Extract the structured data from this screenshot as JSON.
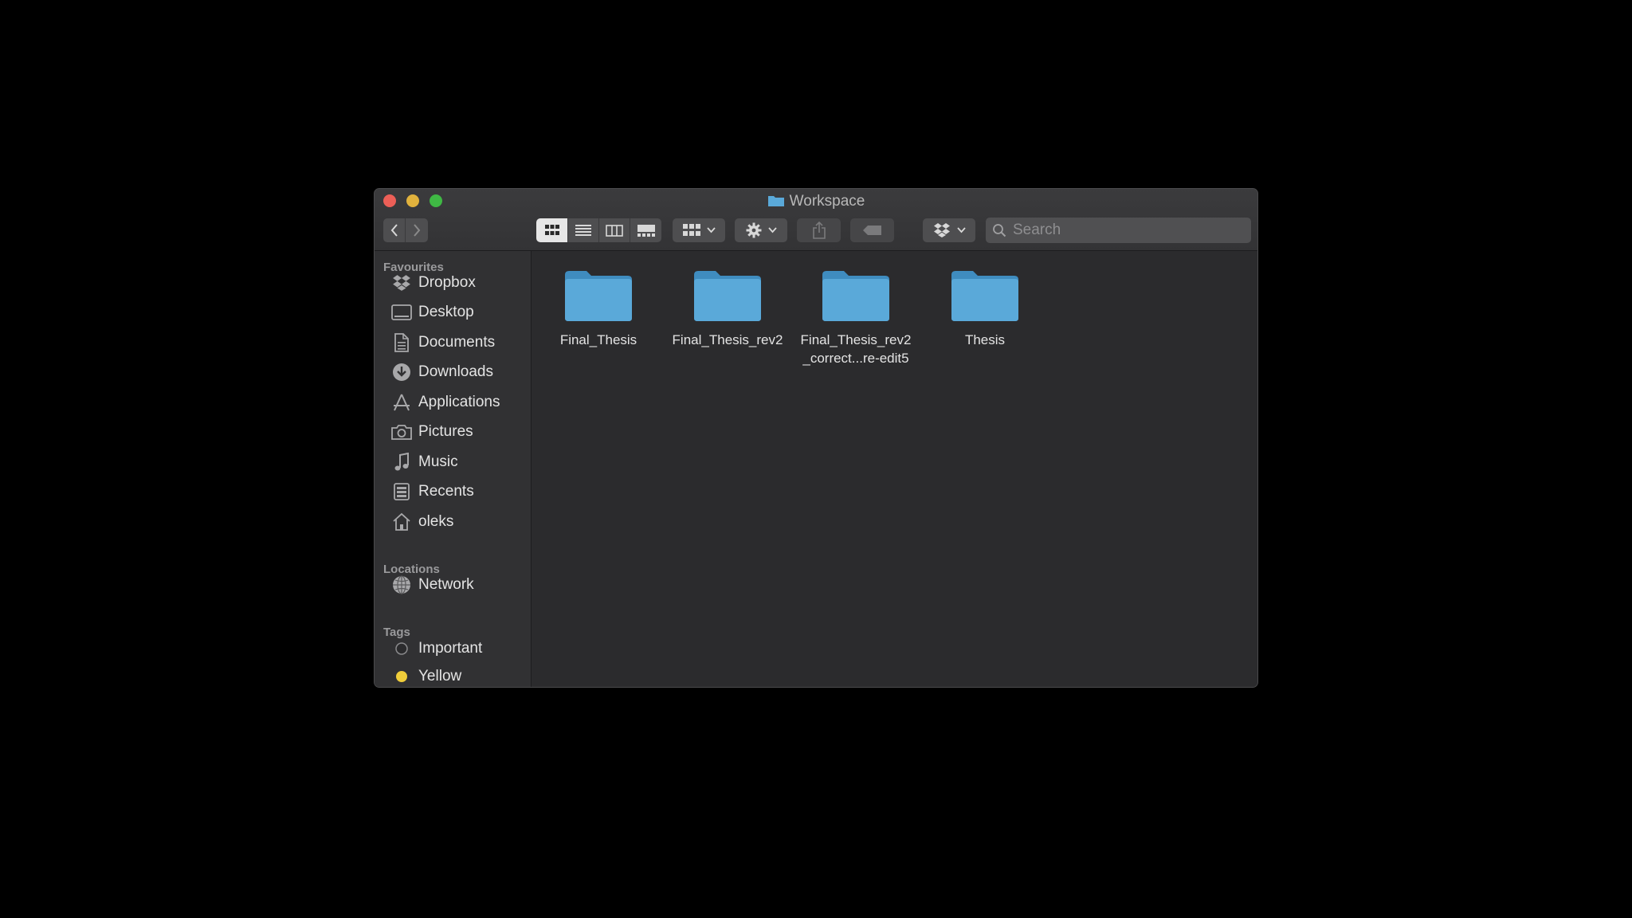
{
  "window": {
    "title": "Workspace"
  },
  "toolbar": {
    "back_icon": "chevron-left-icon",
    "forward_icon": "chevron-right-icon",
    "view_modes": [
      "icon-view",
      "list-view",
      "column-view",
      "gallery-view"
    ],
    "active_view": "icon-view",
    "group_icon": "grid-group-icon",
    "action_icon": "gear-icon",
    "share_icon": "share-icon",
    "tag_icon": "tag-icon",
    "dropbox_icon": "dropbox-icon"
  },
  "search": {
    "placeholder": "Search",
    "value": ""
  },
  "sidebar": {
    "favourites_header": "Favourites",
    "favourites": [
      {
        "label": "Dropbox",
        "icon": "dropbox-icon"
      },
      {
        "label": "Desktop",
        "icon": "desktop-icon"
      },
      {
        "label": "Documents",
        "icon": "documents-icon"
      },
      {
        "label": "Downloads",
        "icon": "downloads-icon"
      },
      {
        "label": "Applications",
        "icon": "applications-icon"
      },
      {
        "label": "Pictures",
        "icon": "camera-icon"
      },
      {
        "label": "Music",
        "icon": "music-note-icon"
      },
      {
        "label": "Recents",
        "icon": "recents-icon"
      },
      {
        "label": "oleks",
        "icon": "home-icon"
      }
    ],
    "locations_header": "Locations",
    "locations": [
      {
        "label": "Network",
        "icon": "globe-icon"
      }
    ],
    "tags_header": "Tags",
    "tags": [
      {
        "label": "Important",
        "color": "#2b2b2d"
      },
      {
        "label": "Yellow",
        "color": "#f0cd3a"
      }
    ]
  },
  "folders": [
    {
      "name": "Final_Thesis"
    },
    {
      "name": "Final_Thesis_rev2"
    },
    {
      "name": "Final_Thesis_rev2\n_correct...re-edit5"
    },
    {
      "name": "Thesis"
    }
  ],
  "colors": {
    "folder_blue": "#5aa9d9",
    "close": "#ec5f57",
    "minimize": "#e1b23d",
    "maximize": "#3fb844"
  }
}
